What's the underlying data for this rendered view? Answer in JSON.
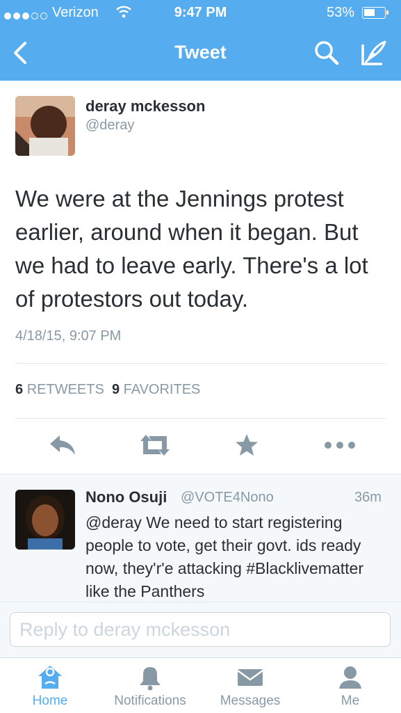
{
  "status_bar": {
    "carrier": "Verizon",
    "time": "9:47 PM",
    "battery": "53%"
  },
  "nav": {
    "title": "Tweet"
  },
  "tweet": {
    "name": "deray mckesson",
    "handle": "@deray",
    "text": "We were at the Jennings protest earlier, around when it began. But we had to leave early. There's a lot of protestors out today.",
    "date": "4/18/15, 9:07 PM",
    "retweets_count": "6",
    "retweets_label": "RETWEETS",
    "favorites_count": "9",
    "favorites_label": "FAVORITES"
  },
  "reply": {
    "name": "Nono Osuji",
    "handle": "@VOTE4Nono",
    "time": "36m",
    "text": "@deray We need to start registering people to vote, get their govt. ids ready now, they'r'e attacking #Blacklivematter like the Panthers"
  },
  "reply_box": {
    "placeholder": "Reply to deray mckesson"
  },
  "tabs": [
    {
      "label": "Home",
      "icon": "home-icon",
      "active": true
    },
    {
      "label": "Notifications",
      "icon": "bell-icon",
      "active": false
    },
    {
      "label": "Messages",
      "icon": "envelope-icon",
      "active": false
    },
    {
      "label": "Me",
      "icon": "person-icon",
      "active": false
    }
  ],
  "colors": {
    "accent": "#55acee",
    "text": "#292f33",
    "muted": "#8899a6"
  }
}
